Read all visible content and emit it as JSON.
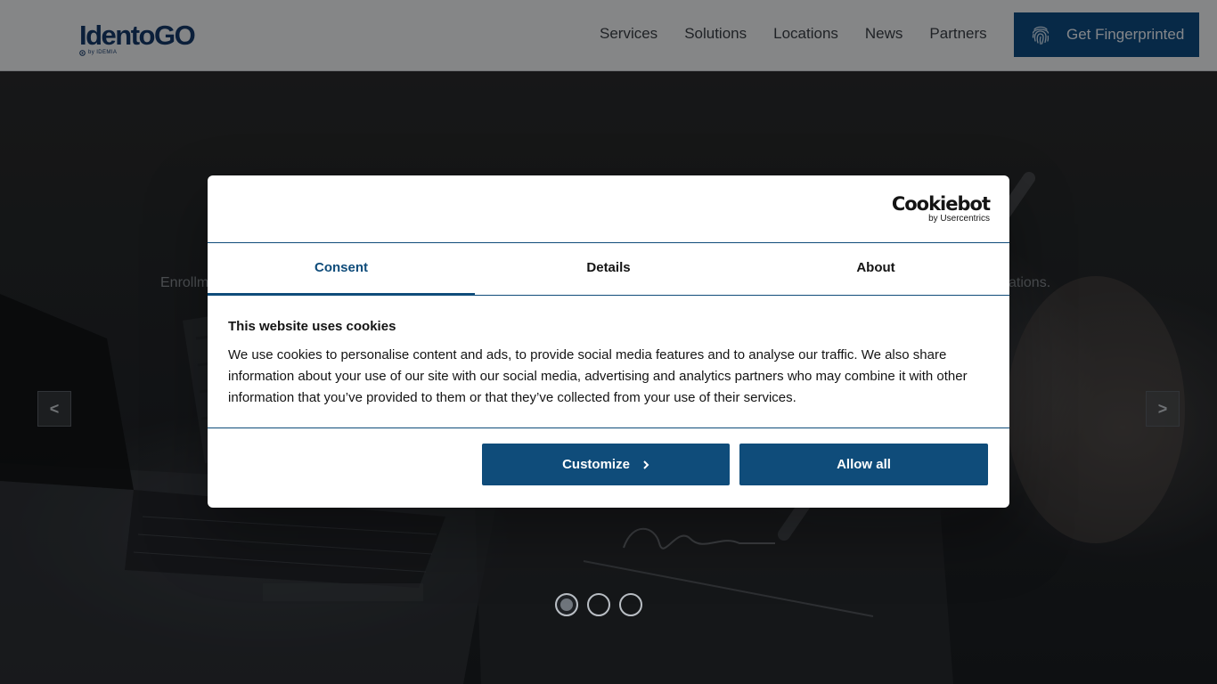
{
  "header": {
    "logo_text": "IdentoGO",
    "logo_sub": "by IDEMIA",
    "nav": [
      "Services",
      "Solutions",
      "Locations",
      "News",
      "Partners"
    ],
    "cta_label": "Get Fingerprinted"
  },
  "hero": {
    "tagline_left": "Enrollm",
    "tagline_right": "cations.",
    "prev_label": "<",
    "next_label": ">",
    "slide_count": 3,
    "active_slide": 1
  },
  "cookie_dialog": {
    "brand_name": "Cookiebot",
    "brand_sub": "by Usercentrics",
    "tabs": [
      "Consent",
      "Details",
      "About"
    ],
    "active_tab": "Consent",
    "title": "This website uses cookies",
    "body": "We use cookies to personalise content and ads, to provide social media features and to analyse our traffic. We also share information about your use of our site with our social media, advertising and analytics partners who may combine it with other information that you’ve provided to them or that they’ve collected from your use of their services.",
    "customize_label": "Customize",
    "allow_all_label": "Allow all"
  },
  "colors": {
    "brand_blue": "#0f4c7a",
    "cta_blue": "#0d4b82",
    "logo_navy": "#143a6b"
  }
}
